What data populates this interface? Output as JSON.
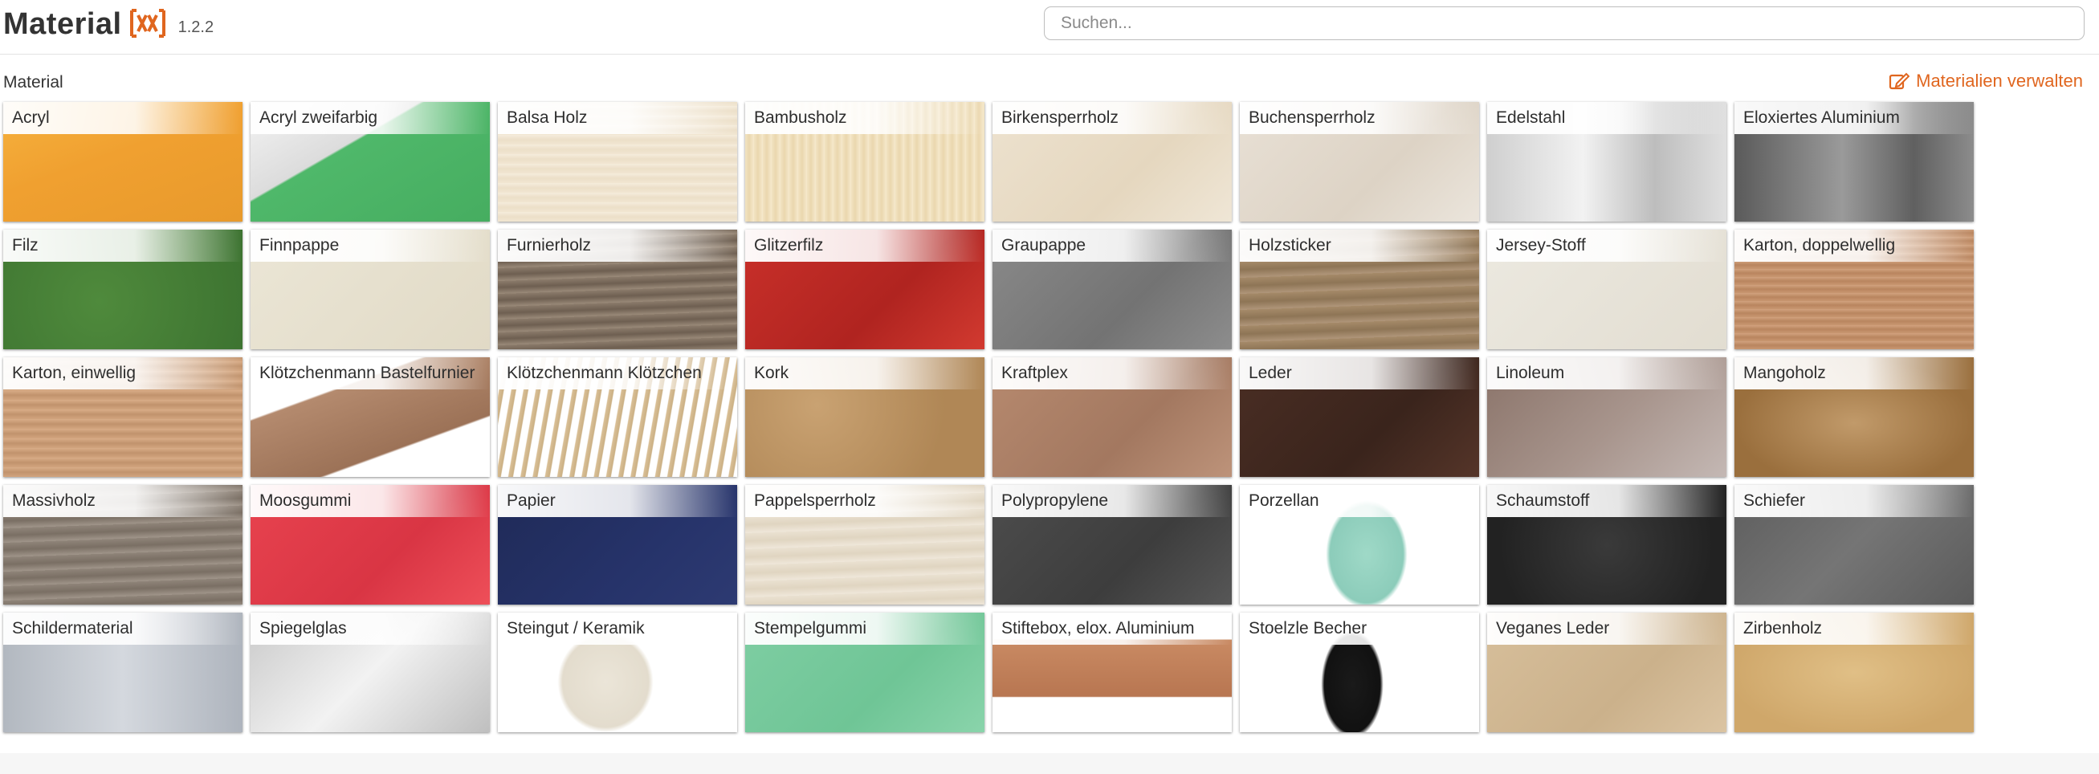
{
  "header": {
    "app_name": "Material",
    "logo": "xx-bracket-logo",
    "version": "1.2.2",
    "search_placeholder": "Suchen..."
  },
  "section": {
    "title": "Material",
    "manage_label": "Materialien verwalten",
    "manage_icon": "edit-icon"
  },
  "colors": {
    "accent": "#e0661f"
  },
  "materials": [
    {
      "label": "Acryl",
      "swatch": "orange-acrylic",
      "bg": "linear-gradient(160deg,#f6b23e 0%,#f0a030 45%,#e89a2c 100%)"
    },
    {
      "label": "Acryl zweifarbig",
      "swatch": "white-green-acrylic",
      "bg": "linear-gradient(150deg,#f4f4f4 0%,#dcdcdc 38%,#4fb86a 39%,#46ad60 100%)"
    },
    {
      "label": "Balsa Holz",
      "swatch": "balsa-wood",
      "bg": "repeating-linear-gradient(0deg,#f1e6d2 0px,#ecdfc8 6px,#f5ecdc 12px)"
    },
    {
      "label": "Bambusholz",
      "swatch": "bamboo-wood",
      "bg": "repeating-linear-gradient(90deg,#f2e3c2 0px,#ead7ae 5px,#f6e9cd 11px)"
    },
    {
      "label": "Birkensperrholz",
      "swatch": "birch-plywood",
      "bg": "linear-gradient(135deg,#ede2cf,#e5d7bf 60%,#efe6d6)"
    },
    {
      "label": "Buchensperrholz",
      "swatch": "beech-plywood",
      "bg": "linear-gradient(135deg,#e8e0d5,#ddd3c5 60%,#ebe5dc)"
    },
    {
      "label": "Edelstahl",
      "swatch": "stainless-steel",
      "bg": "linear-gradient(90deg,#cfcfcf,#f2f2f2 40%,#bdbdbd 70%,#e0e0e0)"
    },
    {
      "label": "Eloxiertes Aluminium",
      "swatch": "anodized-aluminium",
      "bg": "linear-gradient(90deg,#5a5a5a,#9a9a9a 45%,#606060 75%,#8c8c8c)"
    },
    {
      "label": "Filz",
      "swatch": "green-felt",
      "bg": "radial-gradient(circle at 40% 60%,#4f8a3c,#3c7230)"
    },
    {
      "label": "Finnpappe",
      "swatch": "finn-cardboard",
      "bg": "linear-gradient(135deg,#ebe6d6,#e1dac6)"
    },
    {
      "label": "Furnierholz",
      "swatch": "veneer-wood",
      "bg": "repeating-linear-gradient(178deg,#8b7b6b 0px,#6e5f51 8px,#9a8a79 16px)"
    },
    {
      "label": "Glitzerfilz",
      "swatch": "red-glitter-felt",
      "bg": "linear-gradient(135deg,#c9302a,#b02420 60%,#d23a30)"
    },
    {
      "label": "Graupappe",
      "swatch": "grey-cardboard",
      "bg": "linear-gradient(135deg,#8a8a8a,#737373 60%,#8d8d8d)"
    },
    {
      "label": "Holzsticker",
      "swatch": "wood-sticker",
      "bg": "repeating-linear-gradient(178deg,#a58a69 0px,#8e7556 10px,#b0967a 20px)"
    },
    {
      "label": "Jersey-Stoff",
      "swatch": "jersey-fabric",
      "bg": "linear-gradient(135deg,#ece9e0,#e2ddd1)"
    },
    {
      "label": "Karton, doppelwellig",
      "swatch": "double-wall-cardboard",
      "bg": "repeating-linear-gradient(0deg,#c99771 0px,#b9855f 5px,#d2a27e 10px)"
    },
    {
      "label": "Karton, einwellig",
      "swatch": "single-wall-cardboard",
      "bg": "repeating-linear-gradient(0deg,#d2a57f 0px,#c1936d 6px,#d9ad88 12px)"
    },
    {
      "label": "Klötzchenmann Bastelfurnier",
      "swatch": "craft-veneer-sheets",
      "bg": "linear-gradient(160deg,#ffffff 0%,#ffffff 30%,#b48a6e 31%,#9c7257 70%,#ffffff 71%)"
    },
    {
      "label": "Klötzchenmann Klötzchen",
      "swatch": "wooden-sticks",
      "bg": "repeating-linear-gradient(100deg,#ffffff 0px,#ffffff 8px,#d9bf96 9px,#cbb084 14px,#ffffff 15px)"
    },
    {
      "label": "Kork",
      "swatch": "cork",
      "bg": "radial-gradient(circle at 30% 40%,#c9a272,#b08756 70%)"
    },
    {
      "label": "Kraftplex",
      "swatch": "kraftplex",
      "bg": "linear-gradient(135deg,#b78a6f,#a37860 60%,#bd937a)"
    },
    {
      "label": "Leder",
      "swatch": "leather",
      "bg": "linear-gradient(135deg,#4a2e24,#3a241c 60%,#553529)"
    },
    {
      "label": "Linoleum",
      "swatch": "linoleum",
      "bg": "linear-gradient(135deg,#8a7369,#a8958d 55%,#c4b8b4)"
    },
    {
      "label": "Mangoholz",
      "swatch": "mango-wood",
      "bg": "radial-gradient(ellipse at 50% 55%,#c19a6a,#9a6f3d 70%)"
    },
    {
      "label": "Massivholz",
      "swatch": "solid-wood",
      "bg": "repeating-linear-gradient(178deg,#8f8479 0px,#7a6f64 9px,#a0958a 18px)"
    },
    {
      "label": "Moosgummi",
      "swatch": "foam-rubber",
      "bg": "linear-gradient(135deg,#e8434f,#d93544 60%,#ee4f59)"
    },
    {
      "label": "Papier",
      "swatch": "paper",
      "bg": "linear-gradient(135deg,#1f2a57,#26336a 60%,#2d3a72)"
    },
    {
      "label": "Pappelsperrholz",
      "swatch": "poplar-plywood",
      "bg": "repeating-linear-gradient(178deg,#eae1d1 0px,#e0d5c1 10px,#efe7da 20px)"
    },
    {
      "label": "Polypropylene",
      "swatch": "polypropylene",
      "bg": "linear-gradient(135deg,#4d4d4d,#3d3d3d 60%,#575757)"
    },
    {
      "label": "Porzellan",
      "swatch": "porcelain-vase",
      "bg": "radial-gradient(ellipse 17% 45% at 53% 58%,#9fd9c7 0%,#8cccba 90%,#ffffff 100%)"
    },
    {
      "label": "Schaumstoff",
      "swatch": "foam",
      "bg": "radial-gradient(circle at 50% 50%,#3a3a3a,#222222 80%)"
    },
    {
      "label": "Schiefer",
      "swatch": "slate",
      "bg": "linear-gradient(135deg,#5d5d5d,#757575 50%,#5b5b5b)"
    },
    {
      "label": "Schildermaterial",
      "swatch": "sign-material",
      "bg": "linear-gradient(90deg,#b2b8c0,#d4d8de 50%,#aeb4bd)"
    },
    {
      "label": "Spiegelglas",
      "swatch": "mirror-glass",
      "bg": "linear-gradient(135deg,#c9c9c9,#f2f2f2 50%,#bfbfbf)"
    },
    {
      "label": "Steingut / Keramik",
      "swatch": "stoneware-cup",
      "bg": "radial-gradient(ellipse 20% 42% at 45% 58%,#ebe5d8 0%,#e3dccd 90%,#ffffff 100%)"
    },
    {
      "label": "Stempelgummi",
      "swatch": "stamp-rubber",
      "bg": "linear-gradient(135deg,#7fcea3,#6fc596 60%,#8ad4ab)"
    },
    {
      "label": "Stiftebox, elox. Aluminium",
      "swatch": "pen-box",
      "bg": "linear-gradient(180deg,#ffffff 0%,#ffffff 22%,#c98a63 23%,#b87651 70%,#ffffff 71%)"
    },
    {
      "label": "Stoelzle Becher",
      "swatch": "black-cup",
      "bg": "radial-gradient(ellipse 13% 45% at 47% 60%,#1a1a1a 0%,#111111 90%,#ffffff 100%)"
    },
    {
      "label": "Veganes Leder",
      "swatch": "vegan-leather",
      "bg": "linear-gradient(135deg,#d7bf9b,#cbb18b 60%,#dbc4a2)"
    },
    {
      "label": "Zirbenholz",
      "swatch": "swiss-pine-wood",
      "bg": "radial-gradient(ellipse at 50% 50%,#e0bf86,#cfa76a 75%)"
    }
  ]
}
